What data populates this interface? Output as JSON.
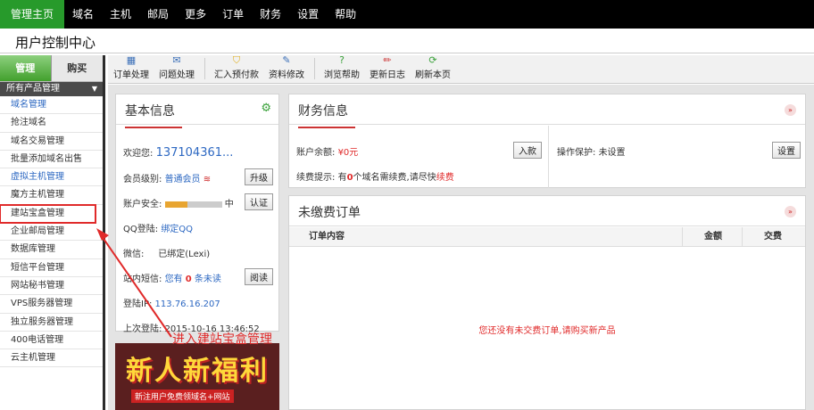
{
  "topnav": [
    "管理主页",
    "域名",
    "主机",
    "邮局",
    "更多",
    "订单",
    "财务",
    "设置",
    "帮助"
  ],
  "page_title": "用户控制中心",
  "tabs": [
    "管理",
    "购买"
  ],
  "sidebar": {
    "header": "所有产品管理",
    "items": [
      "域名管理",
      "抢注域名",
      "域名交易管理",
      "批量添加域名出售",
      "虚拟主机管理",
      "魔方主机管理",
      "建站宝盒管理",
      "企业邮局管理",
      "数据库管理",
      "短信平台管理",
      "网站秘书管理",
      "VPS服务器管理",
      "独立服务器管理",
      "400电话管理",
      "云主机管理"
    ]
  },
  "toolbar": [
    "订单处理",
    "问题处理",
    "汇入预付款",
    "资料修改",
    "浏览帮助",
    "更新日志",
    "刷新本页"
  ],
  "basic": {
    "title": "基本信息",
    "welcome_label": "欢迎您:",
    "welcome_value": "137104361...",
    "level_label": "会员级别:",
    "level_value": "普通会员",
    "upgrade": "升级",
    "security_label": "账户安全:",
    "security_level": "中",
    "security_fraction": 0.4,
    "verify": "认证",
    "qq_label": "QQ登陆:",
    "qq_value": "绑定QQ",
    "wechat_label": "微信:",
    "wechat_value": "已绑定(Lexi)",
    "sms_label": "站内短信:",
    "sms_pre": "您有",
    "sms_count": "0",
    "sms_post": "条未读",
    "read": "阅读",
    "ip_label": "登陆IP:",
    "ip_value": "113.76.16.207",
    "last_label": "上次登陆:",
    "last_value": "2015-10-16 13:46:52"
  },
  "banner": {
    "text": "新人新福利",
    "sub": "新注用户免费领域名+网站"
  },
  "finance": {
    "title": "财务信息",
    "balance_label": "账户余额:",
    "balance_value": "¥0元",
    "deposit": "入款",
    "renew_label": "续费提示:",
    "renew_pre": "有",
    "renew_count": "0",
    "renew_post": "个域名需续费,请尽快",
    "renew_link": "续费",
    "protect_label": "操作保护:",
    "protect_value": "未设置",
    "settings": "设置"
  },
  "orders": {
    "title": "未缴费订单",
    "col_content": "订单内容",
    "col_amount": "金额",
    "col_pay": "交费",
    "empty": "您还没有未交费订单,请购买新产品"
  },
  "annotation": "进入建站宝盒管理",
  "colors": {
    "accent_green": "#279a2b",
    "link_blue": "#2d68c2",
    "alert_red": "#e02a2a"
  }
}
